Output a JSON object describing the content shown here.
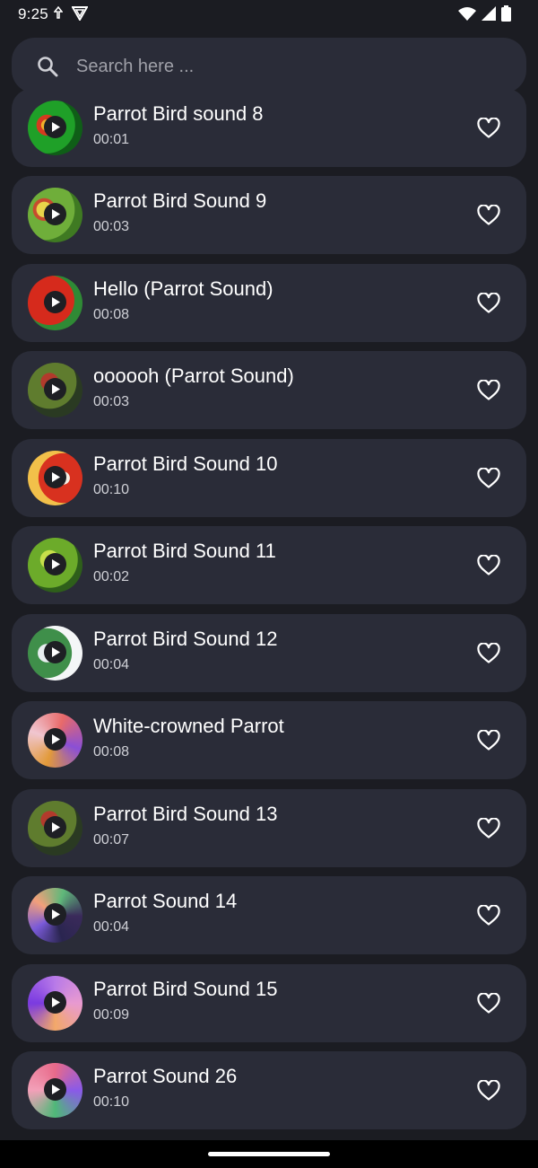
{
  "status": {
    "time": "9:25"
  },
  "search": {
    "placeholder": "Search here ..."
  },
  "items": [
    {
      "title": "Parrot Bird sound 8",
      "duration": "00:01"
    },
    {
      "title": "Parrot Bird Sound 9",
      "duration": "00:03"
    },
    {
      "title": "Hello (Parrot Sound)",
      "duration": "00:08"
    },
    {
      "title": "oooooh (Parrot Sound)",
      "duration": "00:03"
    },
    {
      "title": "Parrot Bird Sound 10",
      "duration": "00:10"
    },
    {
      "title": "Parrot Bird Sound 11",
      "duration": "00:02"
    },
    {
      "title": "Parrot Bird Sound 12",
      "duration": "00:04"
    },
    {
      "title": "White-crowned Parrot",
      "duration": "00:08"
    },
    {
      "title": "Parrot Bird Sound 13",
      "duration": "00:07"
    },
    {
      "title": "Parrot Sound 14",
      "duration": "00:04"
    },
    {
      "title": "Parrot Bird Sound 15",
      "duration": "00:09"
    },
    {
      "title": "Parrot Sound 26",
      "duration": "00:10"
    }
  ],
  "colors": {
    "background": "#1b1c22",
    "card": "#2a2c38",
    "text": "#ffffff",
    "subtext": "#cfd0d6"
  }
}
